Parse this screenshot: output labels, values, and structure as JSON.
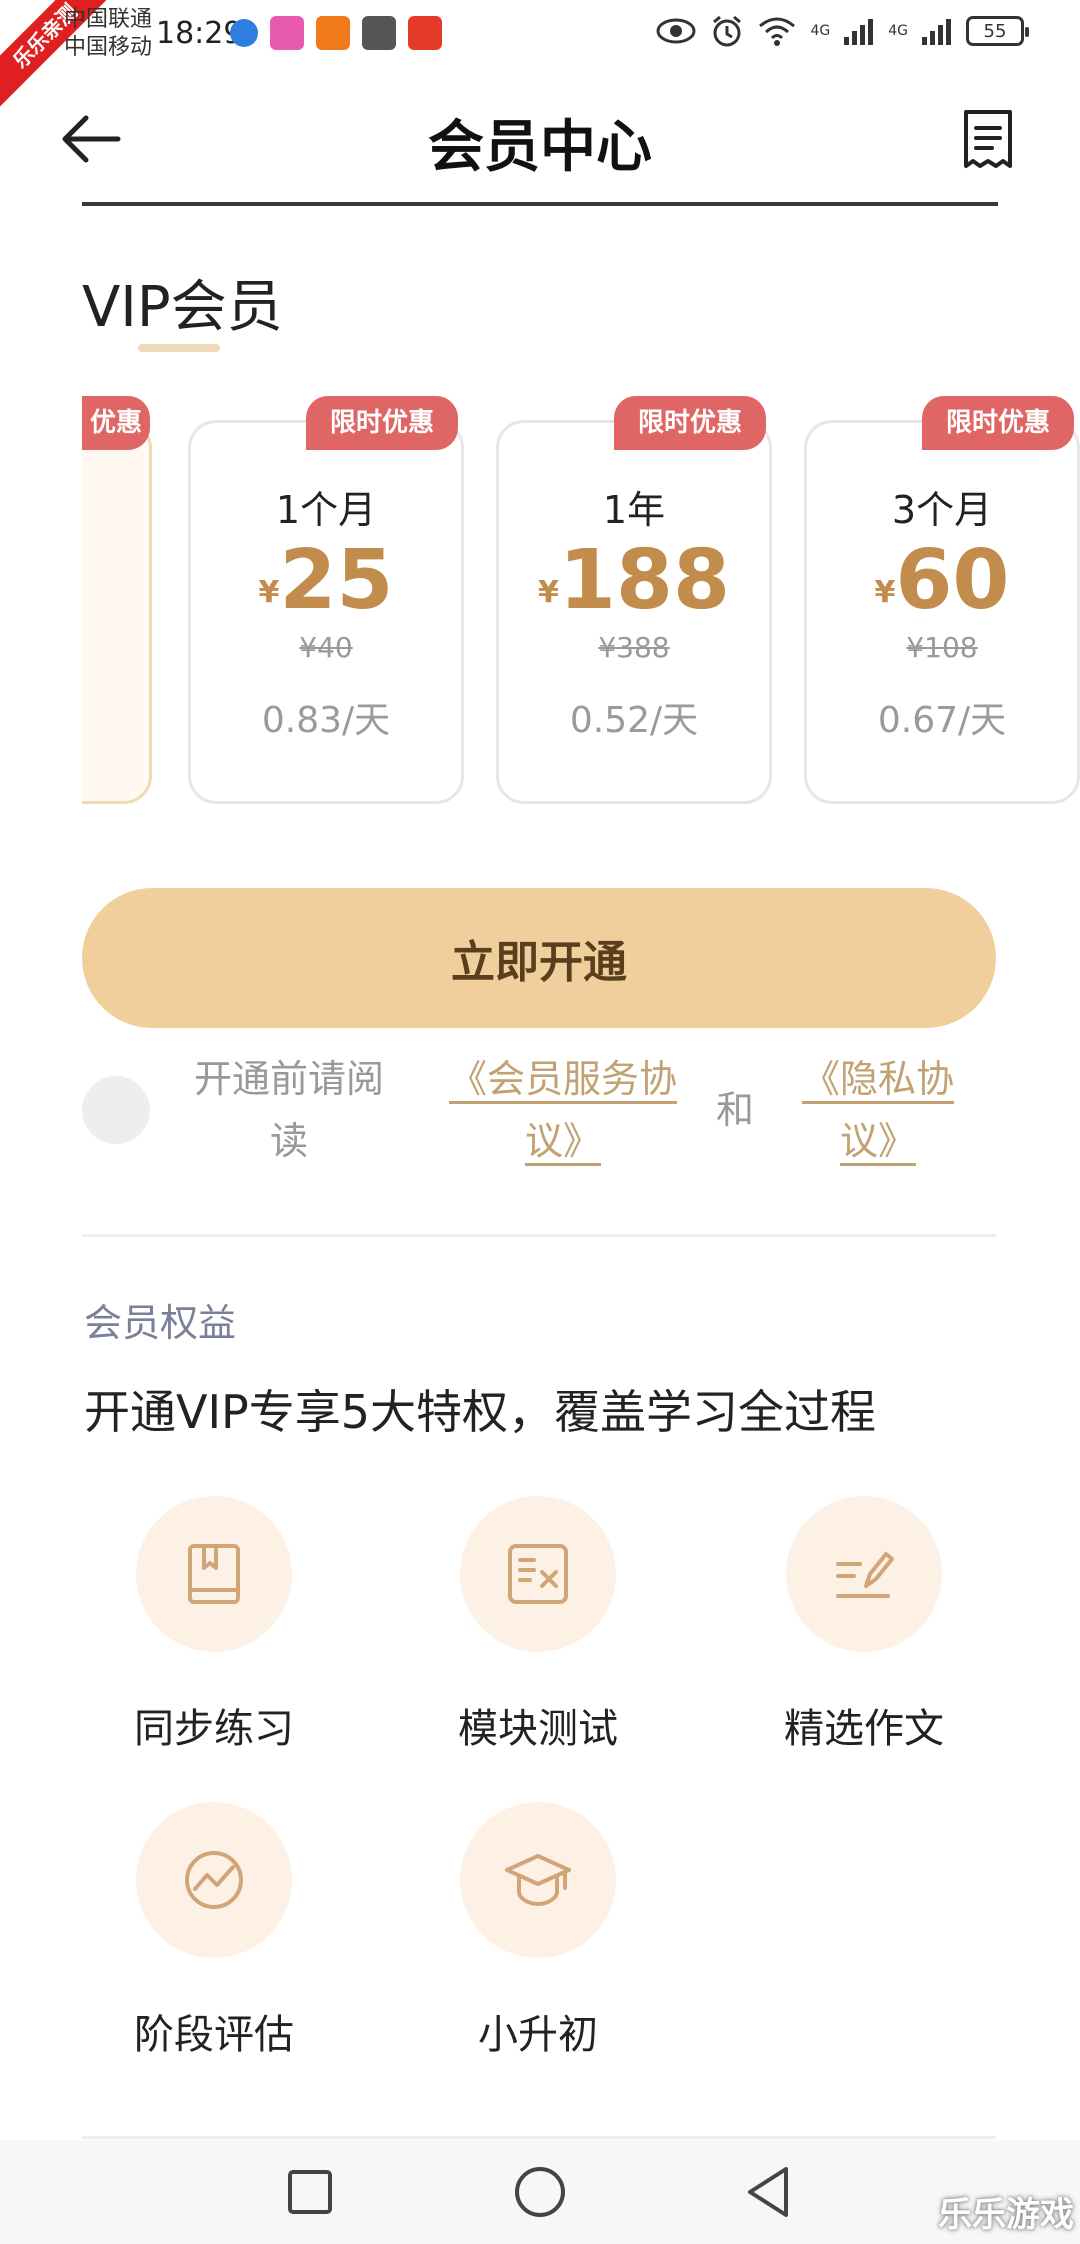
{
  "status_bar": {
    "carrier1": "中国联通",
    "carrier2": "中国移动",
    "time": "18:29",
    "network1": "4G",
    "network2": "4G",
    "battery": "55",
    "corner_tag": "乐乐亲测"
  },
  "header": {
    "title": "会员中心"
  },
  "vip": {
    "section_title": "VIP会员",
    "plans": [
      {
        "badge": "优惠"
      },
      {
        "badge": "限时优惠",
        "name": "1个月",
        "currency": "¥",
        "price": "25",
        "original": "¥40",
        "daily": "0.83/天"
      },
      {
        "badge": "限时优惠",
        "name": "1年",
        "currency": "¥",
        "price": "188",
        "original": "¥388",
        "daily": "0.52/天"
      },
      {
        "badge": "限时优惠",
        "name": "3个月",
        "currency": "¥",
        "price": "60",
        "original": "¥108",
        "daily": "0.67/天"
      }
    ]
  },
  "cta": {
    "label": "立即开通"
  },
  "agreement": {
    "prefix": "开通前请阅读",
    "link1": "《会员服务协议》",
    "and": "和",
    "link2": "《隐私协议》"
  },
  "benefits": {
    "label": "会员权益",
    "title": "开通VIP专享5大特权，覆盖学习全过程",
    "items": [
      {
        "label": "同步练习",
        "icon": "book-icon"
      },
      {
        "label": "模块测试",
        "icon": "test-sheet-icon"
      },
      {
        "label": "精选作文",
        "icon": "writing-icon"
      },
      {
        "label": "阶段评估",
        "icon": "trend-icon"
      },
      {
        "label": "小升初",
        "icon": "graduation-cap-icon"
      }
    ]
  },
  "watermark": "乐乐游戏",
  "colors": {
    "accent_gold": "#c28d4c",
    "cta_bg": "#f1cf9c",
    "badge_red": "#e06565",
    "icon_bg": "#fdf1e6"
  }
}
